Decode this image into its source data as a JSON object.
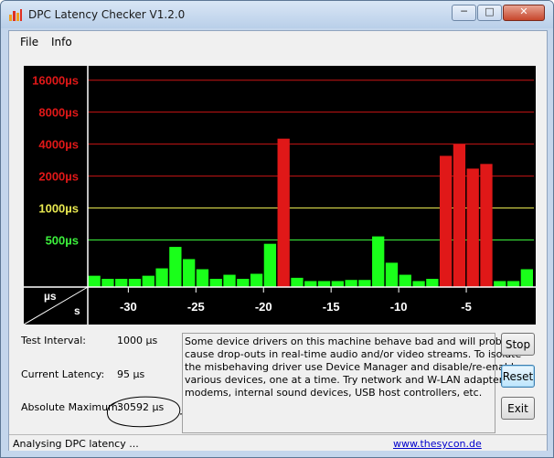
{
  "window": {
    "title": "DPC Latency Checker V1.2.0"
  },
  "title_buttons": {
    "minimize": "─",
    "maximize": "□",
    "close": "✕"
  },
  "menu": {
    "items": [
      "File",
      "Info"
    ]
  },
  "chart_data": {
    "type": "bar",
    "y_scale": "log",
    "x_axis_unit": "s",
    "y_axis_unit": "µs",
    "y_ticks": [
      {
        "label": "16000µs",
        "value": 16000,
        "color": "#e01818"
      },
      {
        "label": "8000µs",
        "value": 8000,
        "color": "#e01818"
      },
      {
        "label": "4000µs",
        "value": 4000,
        "color": "#e01818"
      },
      {
        "label": "2000µs",
        "value": 2000,
        "color": "#e01818"
      },
      {
        "label": "1000µs",
        "value": 1000,
        "color": "#e8e850"
      },
      {
        "label": "500µs",
        "value": 500,
        "color": "#3cf03c"
      }
    ],
    "x_ticks": [
      {
        "label": "-30",
        "value": -30
      },
      {
        "label": "-25",
        "value": -25
      },
      {
        "label": "-20",
        "value": -20
      },
      {
        "label": "-15",
        "value": -15
      },
      {
        "label": "-10",
        "value": -10
      },
      {
        "label": "-5",
        "value": -5
      }
    ],
    "x_range": [
      -33,
      0
    ],
    "bar_x": [
      -32.5,
      -31.5,
      -30.5,
      -29.5,
      -28.5,
      -27.5,
      -26.5,
      -25.5,
      -24.5,
      -23.5,
      -22.5,
      -21.5,
      -20.5,
      -19.5,
      -18.5,
      -17.5,
      -16.5,
      -15.5,
      -14.5,
      -13.5,
      -12.5,
      -11.5,
      -10.5,
      -9.5,
      -8.5,
      -7.5,
      -6.5,
      -5.5,
      -4.5,
      -3.5,
      -2.5,
      -1.5,
      -0.5
    ],
    "values": [
      230,
      215,
      215,
      215,
      230,
      270,
      430,
      330,
      265,
      215,
      235,
      215,
      240,
      460,
      4500,
      220,
      205,
      205,
      205,
      210,
      210,
      540,
      305,
      235,
      205,
      215,
      3100,
      4000,
      2350,
      2600,
      205,
      205,
      265
    ],
    "bar_colors": [
      "#1aff1a",
      "#1aff1a",
      "#1aff1a",
      "#1aff1a",
      "#1aff1a",
      "#1aff1a",
      "#1aff1a",
      "#1aff1a",
      "#1aff1a",
      "#1aff1a",
      "#1aff1a",
      "#1aff1a",
      "#1aff1a",
      "#1aff1a",
      "#e01818",
      "#1aff1a",
      "#1aff1a",
      "#1aff1a",
      "#1aff1a",
      "#1aff1a",
      "#1aff1a",
      "#1aff1a",
      "#1aff1a",
      "#1aff1a",
      "#1aff1a",
      "#1aff1a",
      "#e01818",
      "#e01818",
      "#e01818",
      "#e01818",
      "#1aff1a",
      "#1aff1a",
      "#1aff1a"
    ],
    "y_range": [
      180,
      21000
    ]
  },
  "info": {
    "test_interval_label": "Test Interval:",
    "test_interval_value": "1000 µs",
    "current_latency_label": "Current Latency:",
    "current_latency_value": "95 µs",
    "absolute_maximum_label": "Absolute Maximum:",
    "absolute_maximum_value": "30592 µs"
  },
  "message_lines": [
    "Some device drivers on this machine behave bad and will probably",
    "cause drop-outs in real-time audio and/or video streams. To isolate",
    "the misbehaving driver use Device Manager and disable/re-enable",
    "various devices, one at a time. Try network and W-LAN adapters,",
    "modems, internal sound devices, USB host controllers, etc."
  ],
  "buttons": {
    "stop": "Stop",
    "reset": "Reset",
    "exit": "Exit"
  },
  "status": {
    "text": "Analysing DPC latency ...",
    "link": "www.thesycon.de"
  },
  "colors": {
    "chart_bg": "#000000",
    "green_bar": "#1aff1a",
    "red_bar": "#e01818",
    "grid_red": "#c81414",
    "grid_yellow": "#e8e850",
    "grid_green": "#3cf03c"
  }
}
